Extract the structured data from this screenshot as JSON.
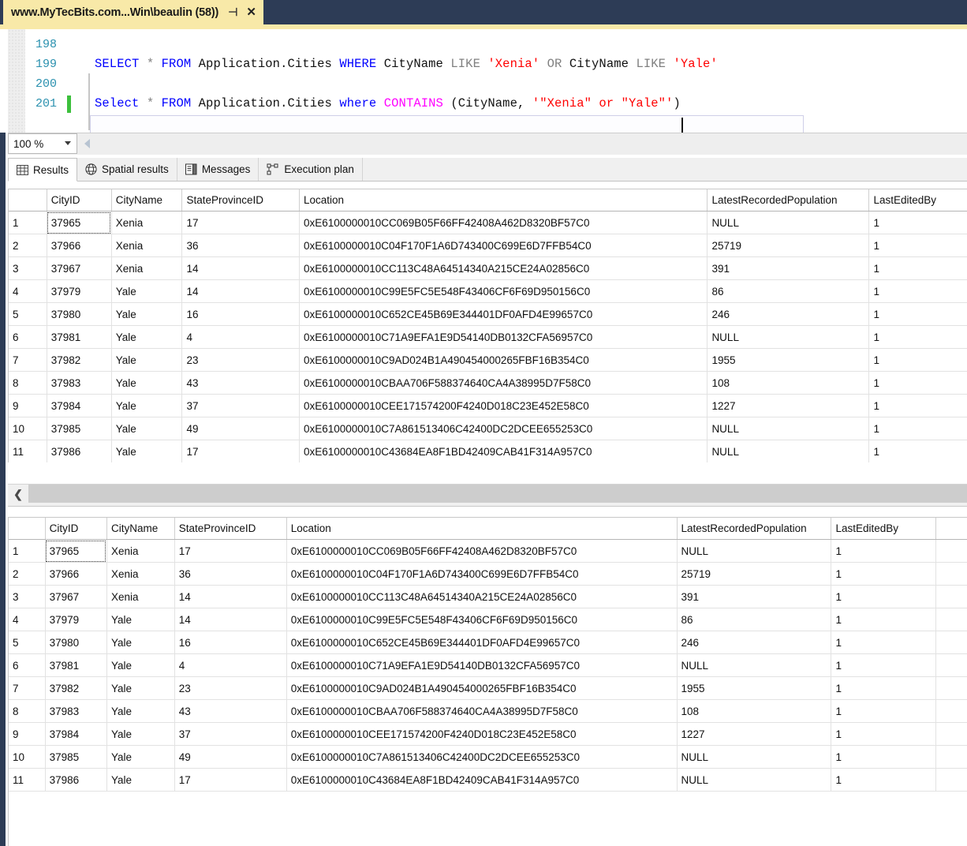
{
  "window": {
    "tab_title": "www.MyTecBits.com...Win\\beaulin (58))",
    "pin_icon": "⊣",
    "close_icon": "✕"
  },
  "editor": {
    "zoom_level": "100 %",
    "lines": [
      {
        "number": "198",
        "changed": false,
        "tokens": []
      },
      {
        "number": "199",
        "changed": false,
        "tokens": [
          {
            "t": "SELECT",
            "c": "k"
          },
          {
            "t": " ",
            "c": "op"
          },
          {
            "t": "*",
            "c": "kg"
          },
          {
            "t": " ",
            "c": "op"
          },
          {
            "t": "FROM",
            "c": "k"
          },
          {
            "t": " ",
            "c": "op"
          },
          {
            "t": "Application",
            "c": "id"
          },
          {
            "t": ".",
            "c": "op"
          },
          {
            "t": "Cities",
            "c": "id"
          },
          {
            "t": " ",
            "c": "op"
          },
          {
            "t": "WHERE",
            "c": "k"
          },
          {
            "t": " ",
            "c": "op"
          },
          {
            "t": "CityName",
            "c": "id"
          },
          {
            "t": " ",
            "c": "op"
          },
          {
            "t": "LIKE",
            "c": "kg"
          },
          {
            "t": " ",
            "c": "op"
          },
          {
            "t": "'Xenia'",
            "c": "str"
          },
          {
            "t": " ",
            "c": "op"
          },
          {
            "t": "OR",
            "c": "kg"
          },
          {
            "t": " ",
            "c": "op"
          },
          {
            "t": "CityName",
            "c": "id"
          },
          {
            "t": " ",
            "c": "op"
          },
          {
            "t": "LIKE",
            "c": "kg"
          },
          {
            "t": " ",
            "c": "op"
          },
          {
            "t": "'Yale'",
            "c": "str"
          }
        ]
      },
      {
        "number": "200",
        "changed": false,
        "tokens": []
      },
      {
        "number": "201",
        "changed": true,
        "tokens": [
          {
            "t": "Select",
            "c": "k"
          },
          {
            "t": " ",
            "c": "op"
          },
          {
            "t": "*",
            "c": "kg"
          },
          {
            "t": " ",
            "c": "op"
          },
          {
            "t": "FROM",
            "c": "k"
          },
          {
            "t": " ",
            "c": "op"
          },
          {
            "t": "Application",
            "c": "id"
          },
          {
            "t": ".",
            "c": "op"
          },
          {
            "t": "Cities",
            "c": "id"
          },
          {
            "t": " ",
            "c": "op"
          },
          {
            "t": "where",
            "c": "k"
          },
          {
            "t": " ",
            "c": "op"
          },
          {
            "t": "CONTAINS",
            "c": "fn"
          },
          {
            "t": " ",
            "c": "op"
          },
          {
            "t": "(",
            "c": "op"
          },
          {
            "t": "CityName",
            "c": "id"
          },
          {
            "t": ", ",
            "c": "op"
          },
          {
            "t": "'\"Xenia\" or \"Yale\"'",
            "c": "str"
          },
          {
            "t": ")",
            "c": "op"
          }
        ]
      }
    ]
  },
  "result_tabs": [
    {
      "label": "Results",
      "icon": "grid-icon",
      "active": true
    },
    {
      "label": "Spatial results",
      "icon": "globe-icon",
      "active": false
    },
    {
      "label": "Messages",
      "icon": "message-document-icon",
      "active": false
    },
    {
      "label": "Execution plan",
      "icon": "execution-plan-icon",
      "active": false
    }
  ],
  "grid": {
    "columns": [
      "",
      "CityID",
      "CityName",
      "StateProvinceID",
      "Location",
      "LatestRecordedPopulation",
      "LastEditedBy"
    ],
    "rows": [
      {
        "n": "1",
        "CityID": "37965",
        "CityName": "Xenia",
        "StateProvinceID": "17",
        "Location": "0xE6100000010CC069B05F66FF42408A462D8320BF57C0",
        "LatestRecordedPopulation": "NULL",
        "LastEditedBy": "1"
      },
      {
        "n": "2",
        "CityID": "37966",
        "CityName": "Xenia",
        "StateProvinceID": "36",
        "Location": "0xE6100000010C04F170F1A6D743400C699E6D7FFB54C0",
        "LatestRecordedPopulation": "25719",
        "LastEditedBy": "1"
      },
      {
        "n": "3",
        "CityID": "37967",
        "CityName": "Xenia",
        "StateProvinceID": "14",
        "Location": "0xE6100000010CC113C48A64514340A215CE24A02856C0",
        "LatestRecordedPopulation": "391",
        "LastEditedBy": "1"
      },
      {
        "n": "4",
        "CityID": "37979",
        "CityName": "Yale",
        "StateProvinceID": "14",
        "Location": "0xE6100000010C99E5FC5E548F43406CF6F69D950156C0",
        "LatestRecordedPopulation": "86",
        "LastEditedBy": "1"
      },
      {
        "n": "5",
        "CityID": "37980",
        "CityName": "Yale",
        "StateProvinceID": "16",
        "Location": "0xE6100000010C652CE45B69E344401DF0AFD4E99657C0",
        "LatestRecordedPopulation": "246",
        "LastEditedBy": "1"
      },
      {
        "n": "6",
        "CityID": "37981",
        "CityName": "Yale",
        "StateProvinceID": "4",
        "Location": "0xE6100000010C71A9EFA1E9D54140DB0132CFA56957C0",
        "LatestRecordedPopulation": "NULL",
        "LastEditedBy": "1"
      },
      {
        "n": "7",
        "CityID": "37982",
        "CityName": "Yale",
        "StateProvinceID": "23",
        "Location": "0xE6100000010C9AD024B1A490454000265FBF16B354C0",
        "LatestRecordedPopulation": "1955",
        "LastEditedBy": "1"
      },
      {
        "n": "8",
        "CityID": "37983",
        "CityName": "Yale",
        "StateProvinceID": "43",
        "Location": "0xE6100000010CBAA706F588374640CA4A38995D7F58C0",
        "LatestRecordedPopulation": "108",
        "LastEditedBy": "1"
      },
      {
        "n": "9",
        "CityID": "37984",
        "CityName": "Yale",
        "StateProvinceID": "37",
        "Location": "0xE6100000010CEE171574200F4240D018C23E452E58C0",
        "LatestRecordedPopulation": "1227",
        "LastEditedBy": "1"
      },
      {
        "n": "10",
        "CityID": "37985",
        "CityName": "Yale",
        "StateProvinceID": "49",
        "Location": "0xE6100000010C7A861513406C42400DC2DCEE655253C0",
        "LatestRecordedPopulation": "NULL",
        "LastEditedBy": "1"
      },
      {
        "n": "11",
        "CityID": "37986",
        "CityName": "Yale",
        "StateProvinceID": "17",
        "Location": "0xE6100000010C43684EA8F1BD42409CAB41F314A957C0",
        "LatestRecordedPopulation": "NULL",
        "LastEditedBy": "1"
      }
    ]
  },
  "scrollbar": {
    "left_arrow": "❮"
  },
  "colors": {
    "tab_active_bg": "#f8e9a8",
    "tabbar_bg": "#2d3c56",
    "null_cell_bg": "#fbf8dd",
    "keyword": "#0000ff",
    "string": "#ff0000",
    "function": "#ff00ff",
    "gray_keyword": "#808080",
    "line_number": "#2b91af"
  }
}
